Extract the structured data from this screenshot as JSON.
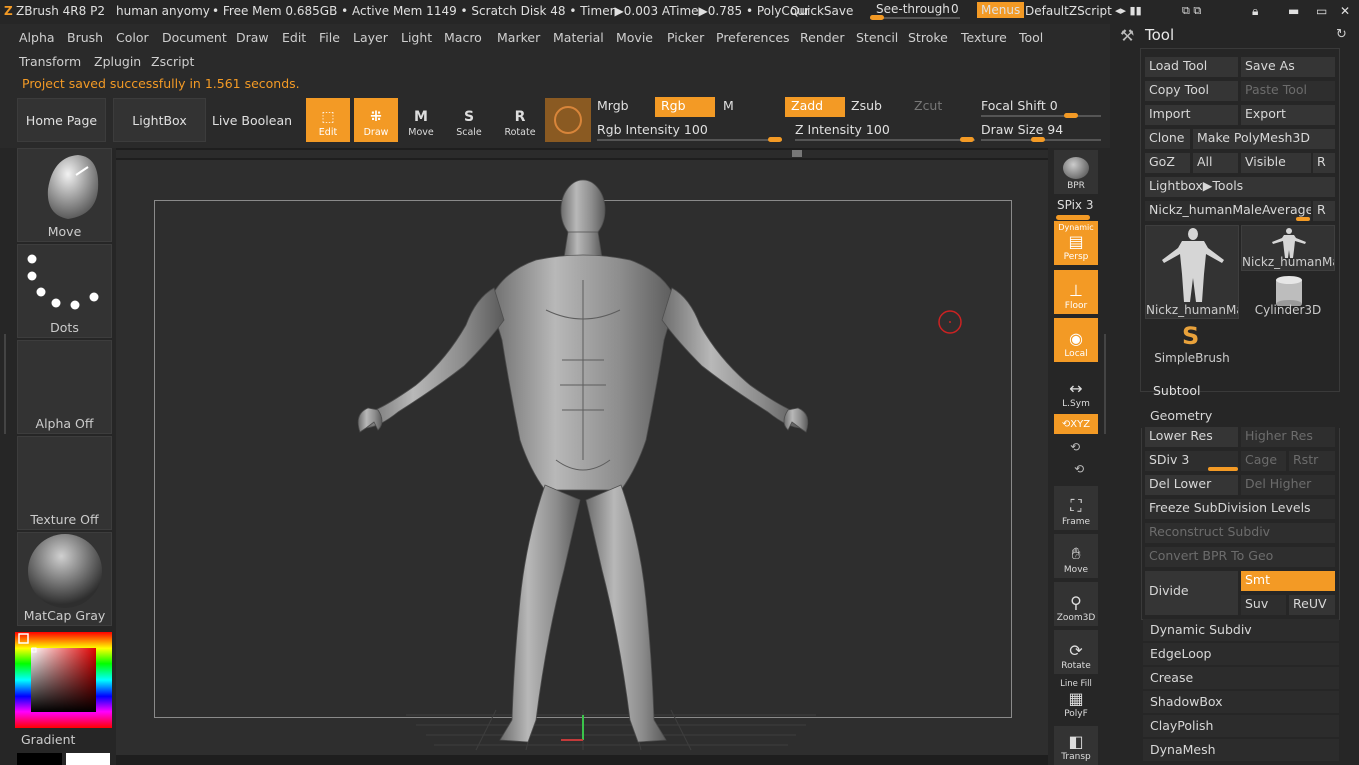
{
  "titlebar": {
    "app": "ZBrush 4R8 P2",
    "project": "human anyomy",
    "stats": "• Free Mem 0.685GB • Active Mem 1149 • Scratch Disk 48 • Timer▶0.003 ATime▶0.785 • PolyCour",
    "quicksave": "QuickSave",
    "see_through_label": "See-through",
    "see_through_value": "0",
    "menus": "Menus",
    "zscript": "DefaultZScript"
  },
  "menu_row1": [
    "Alpha",
    "Brush",
    "Color",
    "Document",
    "Draw",
    "Edit",
    "File",
    "Layer",
    "Light",
    "Macro",
    "Marker",
    "Material",
    "Movie",
    "Picker",
    "Preferences",
    "Render",
    "Stencil",
    "Stroke",
    "Texture",
    "Tool"
  ],
  "menu_row2": [
    "Transform",
    "Zplugin",
    "Zscript"
  ],
  "status_message": "Project saved successfully in 1.561 seconds.",
  "toolbar": {
    "home_page": "Home Page",
    "lightbox": "LightBox",
    "live_boolean": "Live Boolean",
    "edit": "Edit",
    "draw": "Draw",
    "move": "Move",
    "scale": "Scale",
    "rotate": "Rotate",
    "mrgb": "Mrgb",
    "rgb": "Rgb",
    "m": "M",
    "rgb_intensity": "Rgb Intensity 100",
    "zadd": "Zadd",
    "zsub": "Zsub",
    "zcut": "Zcut",
    "z_intensity": "Z Intensity 100",
    "focal_shift": "Focal Shift 0",
    "draw_size": "Draw Size 94"
  },
  "left_panel": {
    "brush": "Move",
    "stroke": "Dots",
    "alpha": "Alpha Off",
    "texture": "Texture Off",
    "material": "MatCap Gray",
    "gradient": "Gradient"
  },
  "shelf": {
    "bpr": "BPR",
    "spix": "SPix 3",
    "persp_top": "Dynamic",
    "persp": "Persp",
    "floor": "Floor",
    "local": "Local",
    "lsym": "L.Sym",
    "xyz": "XYZ",
    "frame": "Frame",
    "move": "Move",
    "zoom3d": "Zoom3D",
    "rotate": "Rotate",
    "linefill": "Line Fill",
    "polyf": "PolyF",
    "transp": "Transp"
  },
  "tool_panel": {
    "title": "Tool",
    "load_tool": "Load Tool",
    "save_as": "Save As",
    "copy_tool": "Copy Tool",
    "paste_tool": "Paste Tool",
    "import": "Import",
    "export": "Export",
    "clone": "Clone",
    "make_polymesh": "Make PolyMesh3D",
    "goz": "GoZ",
    "all": "All",
    "visible": "Visible",
    "r": "R",
    "lightbox_tools": "Lightbox▶Tools",
    "current_tool": "Nickz_humanMaleAverage.",
    "thumbs": [
      "Nickz_humanMa",
      "Nickz_humanMa",
      "Cylinder3D",
      "SimpleBrush"
    ],
    "subtool": "Subtool",
    "geometry": "Geometry",
    "lower_res": "Lower Res",
    "higher_res": "Higher Res",
    "sdiv": "SDiv 3",
    "cage": "Cage",
    "rstr": "Rstr",
    "del_lower": "Del Lower",
    "del_higher": "Del Higher",
    "freeze": "Freeze SubDivision Levels",
    "reconstruct": "Reconstruct Subdiv",
    "convert_bpr": "Convert BPR To Geo",
    "divide": "Divide",
    "smt": "Smt",
    "suv": "Suv",
    "reuv": "ReUV",
    "sections": [
      "Dynamic Subdiv",
      "EdgeLoop",
      "Crease",
      "ShadowBox",
      "ClayPolish",
      "DynaMesh"
    ]
  },
  "colors": {
    "accent": "#f39a25",
    "panel": "#262626",
    "canvas": "#2e2e2e"
  }
}
